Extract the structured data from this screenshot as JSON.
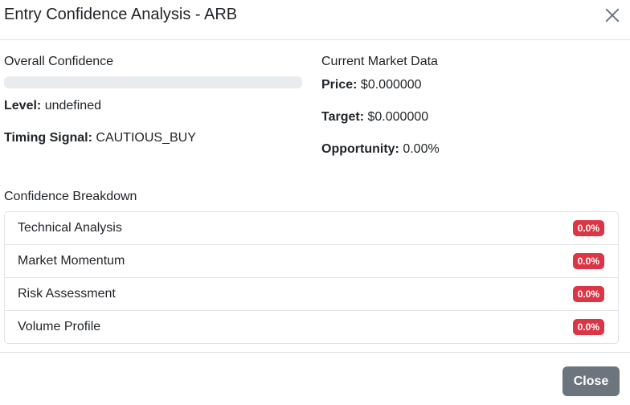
{
  "modal": {
    "title": "Entry Confidence Analysis - ARB"
  },
  "confidence": {
    "label": "Overall Confidence",
    "progress_fraction": 0,
    "level_label": "Level:",
    "level_value": "undefined",
    "timing_label": "Timing Signal:",
    "timing_value": "CAUTIOUS_BUY"
  },
  "market": {
    "label": "Current Market Data",
    "price_label": "Price:",
    "price_value": "$0.000000",
    "target_label": "Target:",
    "target_value": "$0.000000",
    "opportunity_label": "Opportunity:",
    "opportunity_value": "0.00%"
  },
  "breakdown": {
    "title": "Confidence Breakdown",
    "items": [
      {
        "label": "Technical Analysis",
        "value": "0.0%"
      },
      {
        "label": "Market Momentum",
        "value": "0.0%"
      },
      {
        "label": "Risk Assessment",
        "value": "0.0%"
      },
      {
        "label": "Volume Profile",
        "value": "0.0%"
      }
    ],
    "badge_color": "#dc3545"
  },
  "footer": {
    "close_label": "Close"
  }
}
